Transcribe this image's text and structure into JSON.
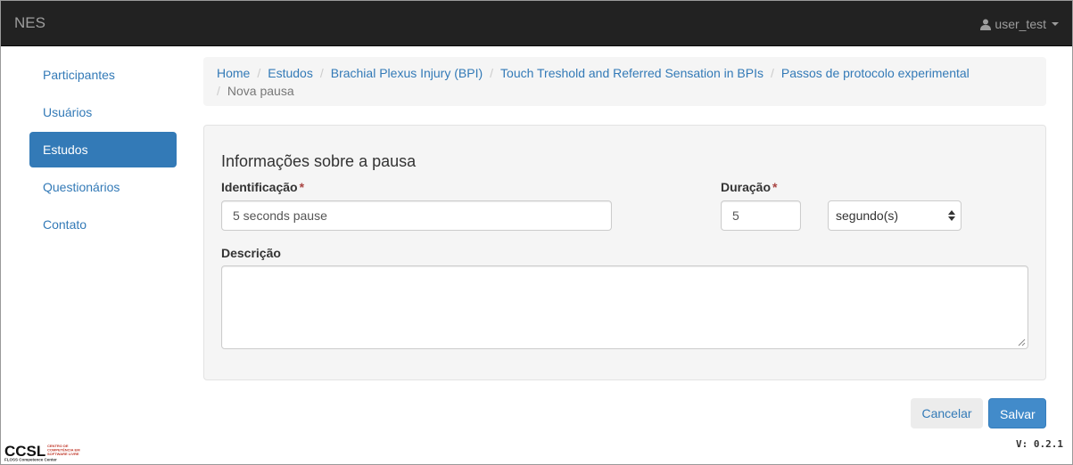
{
  "navbar": {
    "brand": "NES",
    "user": "user_test",
    "user_icon": "user-icon"
  },
  "sidebar": {
    "items": [
      {
        "label": "Participantes",
        "active": false
      },
      {
        "label": "Usuários",
        "active": false
      },
      {
        "label": "Estudos",
        "active": true
      },
      {
        "label": "Questionários",
        "active": false
      },
      {
        "label": "Contato",
        "active": false
      }
    ]
  },
  "breadcrumb": {
    "items": [
      "Home",
      "Estudos",
      "Brachial Plexus Injury (BPI)",
      "Touch Treshold and Referred Sensation in BPIs",
      "Passos de protocolo experimental",
      "Nova pausa"
    ]
  },
  "form": {
    "title": "Informações sobre a pausa",
    "identificacao_label": "Identificação",
    "identificacao_value": "5 seconds pause",
    "duracao_label": "Duração",
    "duracao_value": "5",
    "unit_selected": "segundo(s)",
    "descricao_label": "Descrição",
    "descricao_value": "",
    "required_marker": "*"
  },
  "actions": {
    "cancel_label": "Cancelar",
    "save_label": "Salvar"
  },
  "footer": {
    "logo_text": "CCSL",
    "logo_subtitle": "CENTRO DE COMPETÊNCIA EM SOFTWARE LIVRE",
    "logo_caption": "FLOSS Competence Center",
    "version": "V: 0.2.1"
  },
  "colors": {
    "navbar_bg": "#222222",
    "link": "#337ab7",
    "primary": "#428bca",
    "required": "#a94442",
    "well_bg": "#f5f5f5"
  }
}
